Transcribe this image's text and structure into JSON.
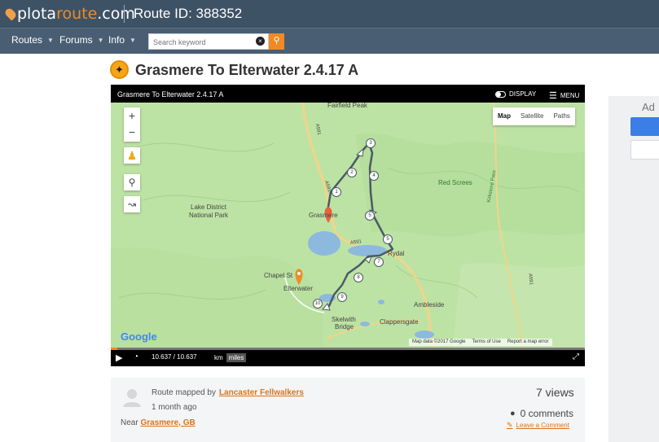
{
  "header": {
    "logo_pre": "plota",
    "logo_accent": "route",
    "logo_post": ".com",
    "route_id_text": "Route ID: 388352"
  },
  "nav": {
    "items": [
      {
        "label": "Routes"
      },
      {
        "label": "Forums"
      },
      {
        "label": "Info"
      }
    ],
    "search_placeholder": "Search keyword"
  },
  "route": {
    "title": "Grasmere To Elterwater 2.4.17 A"
  },
  "player": {
    "header_title": "Grasmere To Elterwater 2.4.17 A",
    "display_label": "DISPLAY",
    "menu_label": "MENU",
    "distance_readout": "10.637 / 10.637",
    "unit_km": "km",
    "unit_miles": "miles"
  },
  "map": {
    "types": [
      {
        "label": "Map"
      },
      {
        "label": "Satellite"
      },
      {
        "label": "Paths"
      }
    ],
    "active_type": "Map",
    "places": {
      "fairfield": "Fairfield Peak",
      "lake_district_1": "Lake District",
      "lake_district_2": "National Park",
      "grasmere": "Grasmere",
      "red_screes": "Red Screes",
      "rydal": "Rydal",
      "chapel_st": "Chapel St",
      "elterwater": "Elterwater",
      "ambleside": "Ambleside",
      "skelwith_1": "Skelwith",
      "skelwith_2": "Bridge",
      "clappersgate": "Clappersgate",
      "road_a591_top": "A591",
      "road_a591_mid": "A591",
      "road_a591_low": "A591",
      "road_a591_right": "A591",
      "kirkstone": "Kirkstone Pass"
    },
    "waypoints": [
      "1",
      "2",
      "3",
      "4",
      "5",
      "5",
      "7",
      "8",
      "9",
      "10"
    ],
    "google": "Google",
    "footer": {
      "map_data": "Map data ©2017 Google",
      "terms": "Terms of Use",
      "report": "Report a map error"
    }
  },
  "details": {
    "mapped_by_label": "Route mapped by",
    "author": "Lancaster Fellwalkers",
    "time_ago": "1 month ago",
    "near_label": "Near",
    "near_place": "Grasmere, GB",
    "views": "7 views",
    "comments": "0 comments",
    "leave_comment": "Leave a Comment"
  },
  "ad": {
    "label": "Ad"
  },
  "colors": {
    "accent": "#f08a24",
    "topbar": "#3e5266",
    "navbar": "#4a5e73",
    "map_green": "#bfe2a7",
    "route_line": "#4b5a66"
  }
}
